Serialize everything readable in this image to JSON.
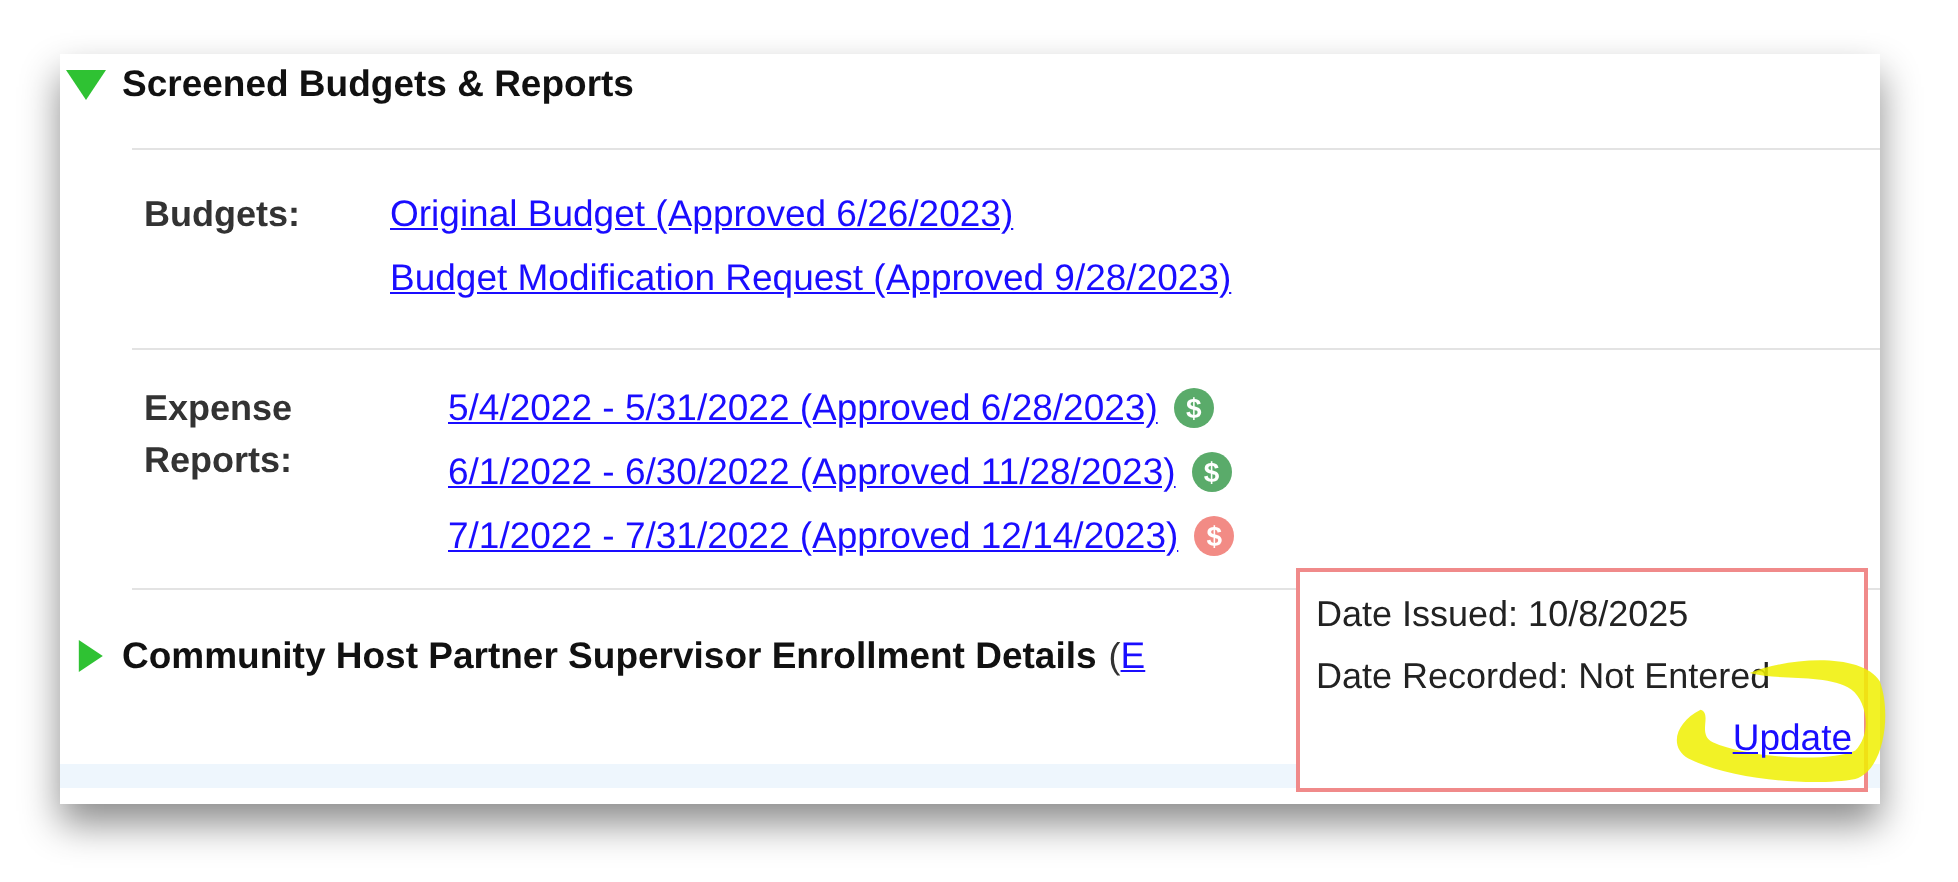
{
  "sections": [
    {
      "title": "Screened Budgets & Reports",
      "expanded": true,
      "groups": [
        {
          "label": "Budgets:",
          "items": [
            {
              "text": "Original Budget (Approved 6/26/2023)"
            },
            {
              "text": "Budget Modification Request (Approved 9/28/2023)"
            }
          ]
        },
        {
          "label": "Expense Reports:",
          "items": [
            {
              "text": "5/4/2022 - 5/31/2022 (Approved 6/28/2023)",
              "payment_icon": "$",
              "color": "#5aab6a"
            },
            {
              "text": "6/1/2022 - 6/30/2022 (Approved 11/28/2023)",
              "payment_icon": "$",
              "color": "#5aab6a"
            },
            {
              "text": "7/1/2022 - 7/31/2022 (Approved 12/14/2023)",
              "payment_icon": "$",
              "color": "#f28b85"
            }
          ]
        }
      ]
    },
    {
      "title": "Community Host Partner Supervisor Enrollment Details",
      "expanded": false,
      "paren": "(",
      "link": "E"
    }
  ],
  "popup": {
    "lines": [
      "Date Issued: 10/8/2025",
      "Date Recorded: Not Entered"
    ],
    "link": "Update"
  }
}
